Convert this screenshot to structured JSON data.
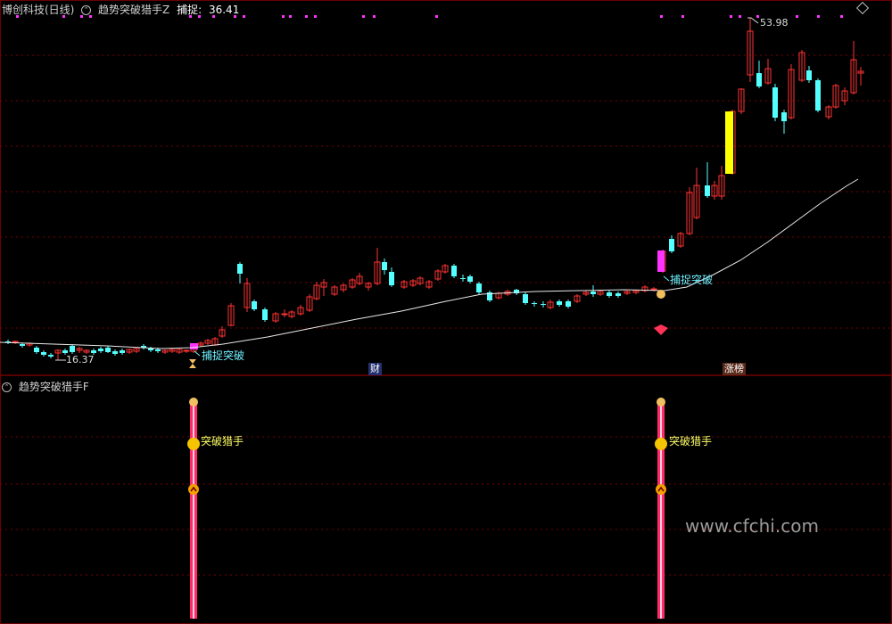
{
  "main_panel": {
    "stock_name": "博创科技(日线)",
    "indicator_name": "趋势突破猎手Z",
    "capture_label": "捕捉:",
    "capture_value": "36.41"
  },
  "sub_panel": {
    "indicator_name": "趋势突破猎手F"
  },
  "annotations": {
    "low_price": "16.37",
    "high_price": "53.98",
    "signal_text": "捕捉突破",
    "signal_text_2": "捕捉突破",
    "hunter_text": "突破猎手",
    "hunter_text_2": "突破猎手",
    "tag_finance": "财",
    "tag_limit": "涨榜"
  },
  "watermark": "www.cfchi.com",
  "colors": {
    "background": "#000000",
    "up": "#ff3333",
    "down": "#54ffff",
    "ma": "#e8e8e8",
    "grid": "#7a0000",
    "magenta": "#ff33ff",
    "yellow": "#ffff00",
    "label_yellow": "#ffff66",
    "label_cyan": "#6ff0ff"
  },
  "icons": [
    "settings-icon",
    "hourglass-icon",
    "money-bag-icon",
    "gem-icon",
    "smiley-icon",
    "up-chevron-icon"
  ]
}
